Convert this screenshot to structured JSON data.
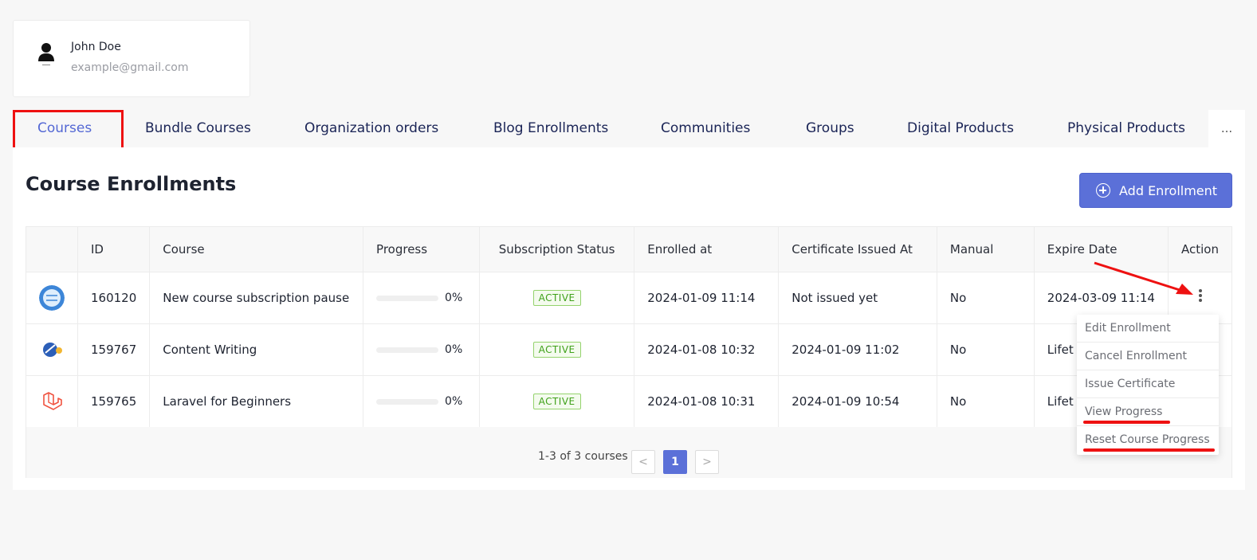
{
  "user": {
    "name": "John Doe",
    "email": "example@gmail.com"
  },
  "tabs": [
    {
      "label": "Courses",
      "active": true
    },
    {
      "label": "Bundle Courses"
    },
    {
      "label": "Organization orders"
    },
    {
      "label": "Blog Enrollments"
    },
    {
      "label": "Communities"
    },
    {
      "label": "Groups"
    },
    {
      "label": "Digital Products"
    },
    {
      "label": "Physical Products"
    }
  ],
  "tabs_more": "...",
  "page": {
    "title": "Course Enrollments",
    "add_button": "Add Enrollment"
  },
  "table": {
    "headers": [
      "ID",
      "Course",
      "Progress",
      "Subscription Status",
      "Enrolled at",
      "Certificate Issued At",
      "Manual",
      "Expire Date",
      "Action"
    ],
    "rows": [
      {
        "id": "160120",
        "course": "New course subscription pause",
        "progress": "0%",
        "progress_value": 0,
        "status": "ACTIVE",
        "enrolled_at": "2024-01-09 11:14",
        "certificate": "Not issued yet",
        "manual": "No",
        "expire": "2024-03-09 11:14",
        "thumb": "globe-course-icon"
      },
      {
        "id": "159767",
        "course": "Content Writing",
        "progress": "0%",
        "progress_value": 0,
        "status": "ACTIVE",
        "enrolled_at": "2024-01-08 10:32",
        "certificate": "2024-01-09 11:02",
        "manual": "No",
        "expire": "Lifet",
        "thumb": "writing-course-icon"
      },
      {
        "id": "159765",
        "course": "Laravel for Beginners",
        "progress": "0%",
        "progress_value": 0,
        "status": "ACTIVE",
        "enrolled_at": "2024-01-08 10:31",
        "certificate": "2024-01-09 10:54",
        "manual": "No",
        "expire": "Lifet",
        "thumb": "laravel-logo-icon"
      }
    ]
  },
  "pagination": {
    "info": "1-3 of 3 courses",
    "prev": "<",
    "current": "1",
    "next": ">"
  },
  "action_menu": [
    "Edit Enrollment",
    "Cancel Enrollment",
    "Issue Certificate",
    "View Progress",
    "Reset Course Progress"
  ],
  "colors": {
    "accent": "#5b70d8",
    "annotation": "#ee1111",
    "badge_green": "#3fa11a"
  }
}
